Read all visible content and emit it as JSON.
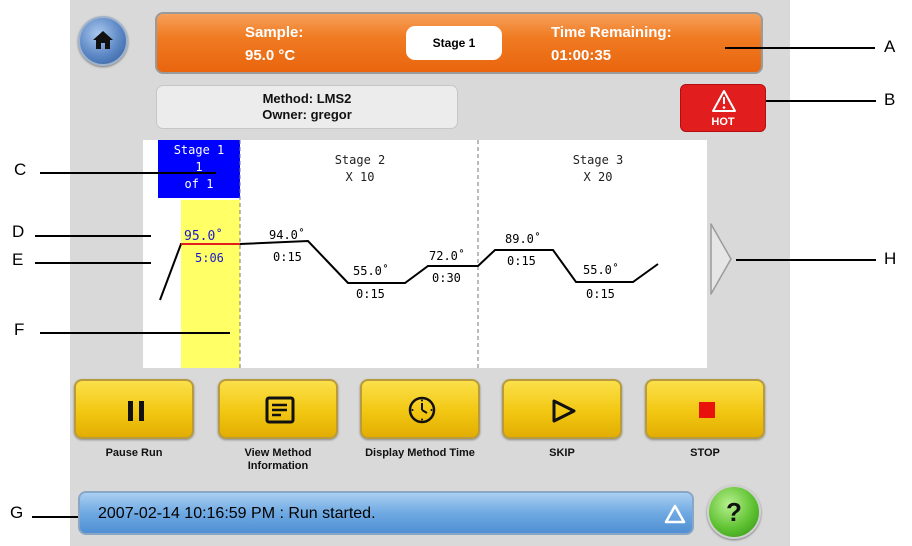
{
  "header": {
    "sample_label": "Sample:",
    "sample_value": "95.0 °C",
    "stage_button": "Stage 1",
    "time_label": "Time Remaining:",
    "time_value": "01:00:35"
  },
  "method": {
    "method_line": "Method: LMS2",
    "owner_line": "Owner: gregor"
  },
  "hot_badge": "HOT",
  "profile": {
    "stage1": {
      "title": "Stage 1",
      "count": "1",
      "of": "of 1"
    },
    "stage2": {
      "title": "Stage 2",
      "repeat": "X 10"
    },
    "stage3": {
      "title": "Stage 3",
      "repeat": "X 20"
    },
    "steps": [
      {
        "temp": "95.0˚",
        "time": "5:06"
      },
      {
        "temp": "94.0˚",
        "time": "0:15"
      },
      {
        "temp": "55.0˚",
        "time": "0:15"
      },
      {
        "temp": "72.0˚",
        "time": "0:30"
      },
      {
        "temp": "89.0˚",
        "time": "0:15"
      },
      {
        "temp": "55.0˚",
        "time": "0:15"
      }
    ]
  },
  "controls": [
    {
      "label": "Pause Run",
      "icon": "pause-icon"
    },
    {
      "label": "View Method Information",
      "icon": "document-icon"
    },
    {
      "label": "Display Method Time",
      "icon": "clock-icon"
    },
    {
      "label": "SKIP",
      "icon": "play-outline-icon"
    },
    {
      "label": "STOP",
      "icon": "stop-icon"
    }
  ],
  "log": {
    "message": "2007-02-14 10:16:59 PM : Run started."
  },
  "help_label": "?",
  "callouts": [
    "A",
    "B",
    "C",
    "D",
    "E",
    "F",
    "G",
    "H"
  ],
  "colors": {
    "accent_orange": "#f07b22",
    "button_yellow": "#f2c712",
    "hot_red": "#e21d1d",
    "stage_blue": "#0000ff",
    "current_step_yellow": "#ffff66"
  }
}
